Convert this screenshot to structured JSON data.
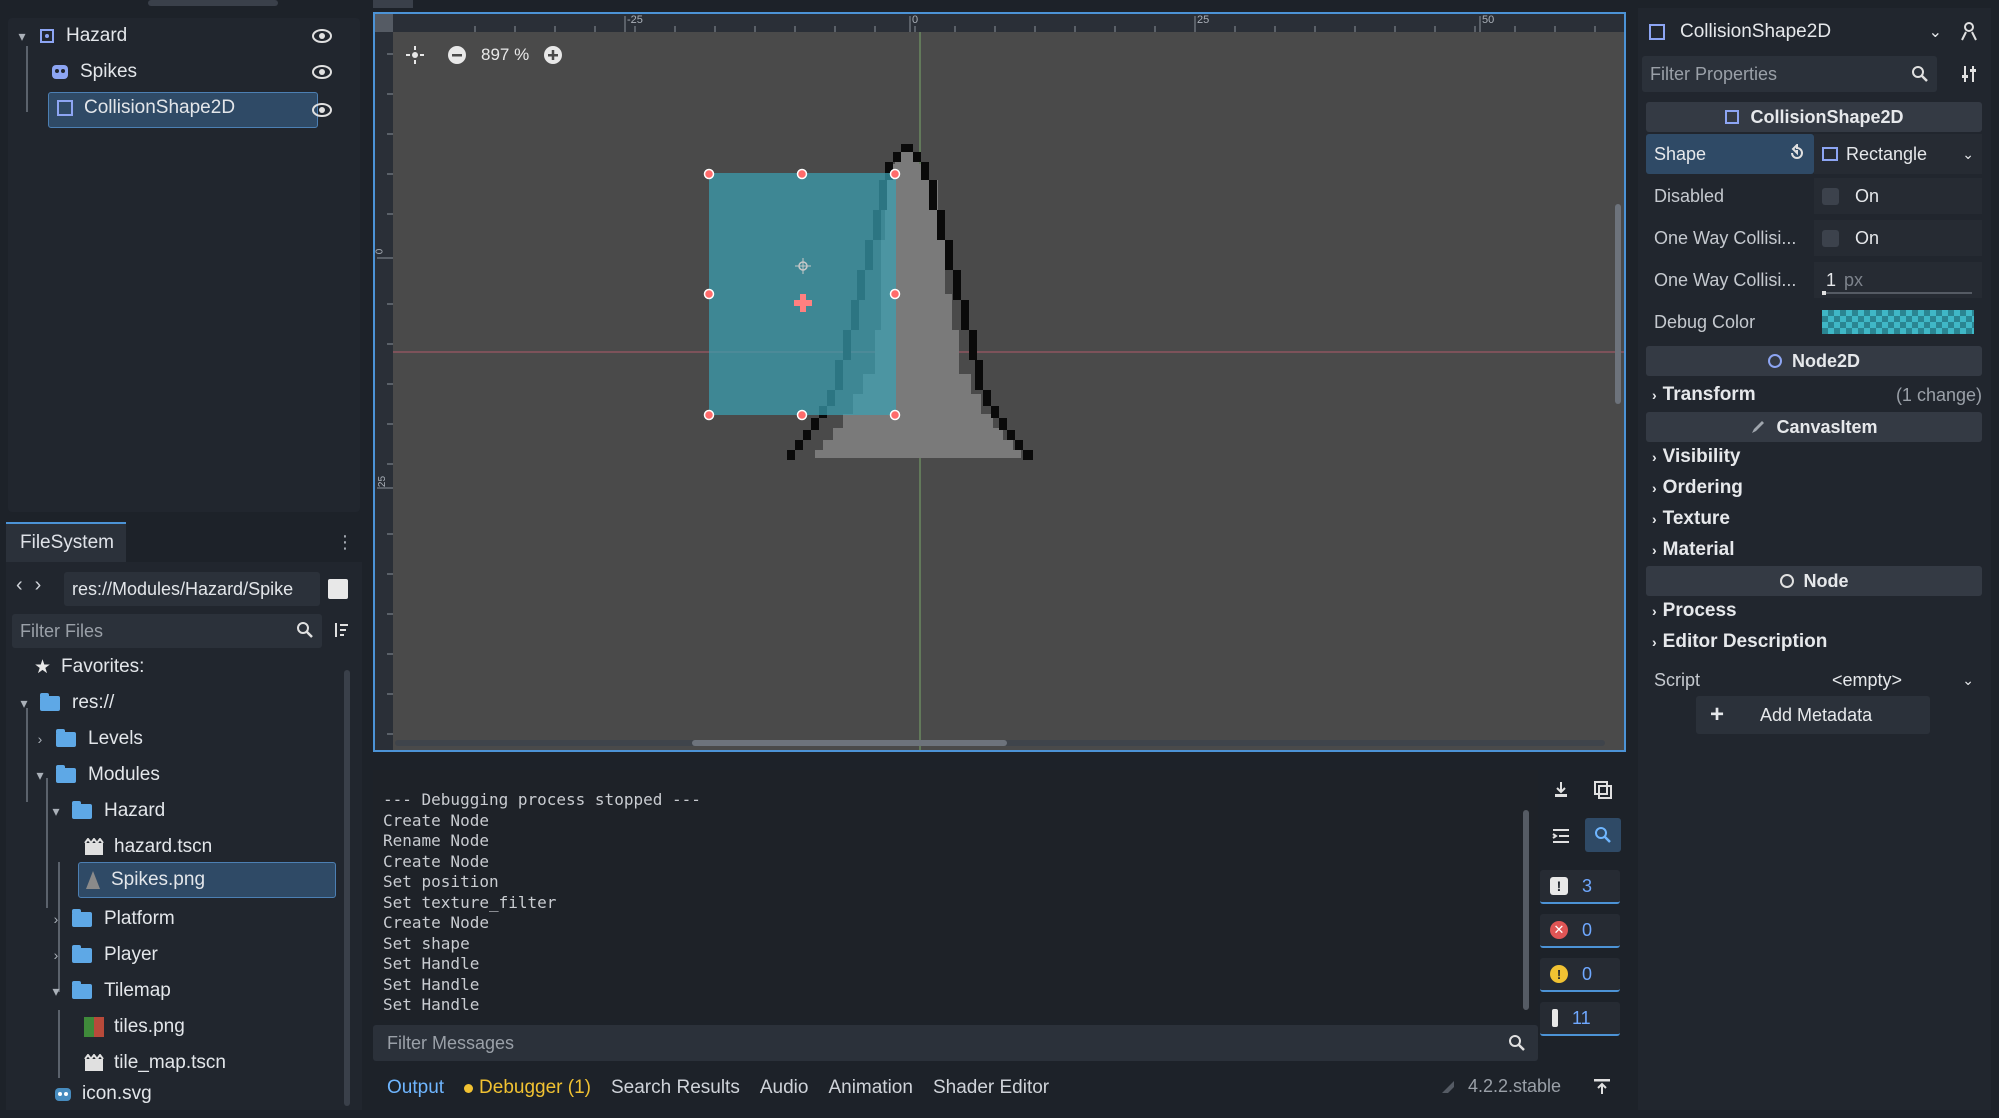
{
  "scene_tree": {
    "nodes": [
      {
        "label": "Hazard"
      },
      {
        "label": "Spikes"
      },
      {
        "label": "CollisionShape2D"
      }
    ]
  },
  "filesystem": {
    "tab_label": "FileSystem",
    "path": "res://Modules/Hazard/Spike",
    "filter_placeholder": "Filter Files",
    "items": [
      {
        "label": "Favorites:"
      },
      {
        "label": "res://"
      },
      {
        "label": "Levels"
      },
      {
        "label": "Modules"
      },
      {
        "label": "Hazard"
      },
      {
        "label": "hazard.tscn"
      },
      {
        "label": "Spikes.png"
      },
      {
        "label": "Platform"
      },
      {
        "label": "Player"
      },
      {
        "label": "Tilemap"
      },
      {
        "label": "tiles.png"
      },
      {
        "label": "tile_map.tscn"
      },
      {
        "label": "icon.svg"
      }
    ]
  },
  "viewport": {
    "zoom": "897 %",
    "ruler_labels": [
      "-25",
      "0",
      "25",
      "50"
    ],
    "ruler_left_labels": [
      "0",
      "25"
    ]
  },
  "output": {
    "log": "--- Debugging process stopped ---\nCreate Node\nRename Node\nCreate Node\nSet position\nSet texture_filter\nCreate Node\nSet shape\nSet Handle\nSet Handle\nSet Handle",
    "filter_placeholder": "Filter Messages",
    "counts": {
      "messages": "3",
      "errors": "0",
      "warnings": "0",
      "verbose": "11"
    },
    "tabs": [
      "Output",
      "Debugger (1)",
      "Search Results",
      "Audio",
      "Animation",
      "Shader Editor"
    ],
    "version": "4.2.2.stable"
  },
  "inspector": {
    "node_name": "CollisionShape2D",
    "filter_placeholder": "Filter Properties",
    "section_collision": "CollisionShape2D",
    "shape_label": "Shape",
    "shape_value": "Rectangle",
    "disabled_label": "Disabled",
    "disabled_value": "On",
    "oneway_label": "One Way Collisi...",
    "oneway_value": "On",
    "oneway_margin_label": "One Way Collisi...",
    "oneway_margin_value": "1",
    "oneway_margin_unit": "px",
    "debug_color_label": "Debug Color",
    "section_node2d": "Node2D",
    "transform_label": "Transform",
    "transform_note": "(1 change)",
    "section_canvas": "CanvasItem",
    "groups_canvas": [
      "Visibility",
      "Ordering",
      "Texture",
      "Material"
    ],
    "section_node": "Node",
    "groups_node": [
      "Process",
      "Editor Description"
    ],
    "script_label": "Script",
    "script_value": "<empty>",
    "add_metadata": "Add Metadata"
  },
  "colors": {
    "accent": "#4c93d6",
    "shape_fill": "#3a8c99",
    "handle": "#ff5a5a",
    "selection": "#2f4a66"
  }
}
